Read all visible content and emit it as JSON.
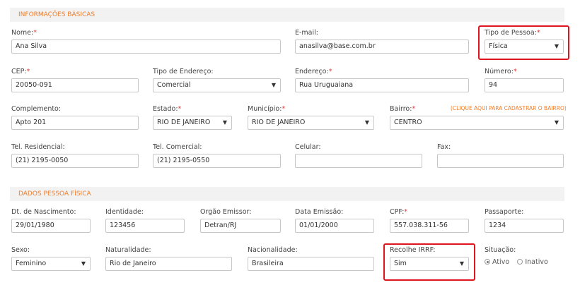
{
  "sections": {
    "basic": "INFORMAÇÕES BÁSICAS",
    "person": "DADOS PESSOA FÍSICA"
  },
  "req": "*",
  "fields": {
    "nome": {
      "label": "Nome:",
      "value": "Ana Silva"
    },
    "email": {
      "label": "E-mail:",
      "value": "anasilva@base.com.br"
    },
    "tipo_pessoa": {
      "label": "Tipo de Pessoa:",
      "value": "Física"
    },
    "cep": {
      "label": "CEP:",
      "value": "20050-091"
    },
    "tipo_endereco": {
      "label": "Tipo de Endereço:",
      "value": "Comercial"
    },
    "endereco": {
      "label": "Endereço:",
      "value": "Rua Uruguaiana"
    },
    "numero": {
      "label": "Número:",
      "value": "94"
    },
    "complemento": {
      "label": "Complemento:",
      "value": "Apto 201"
    },
    "estado": {
      "label": "Estado:",
      "value": "RIO DE JANEIRO"
    },
    "municipio": {
      "label": "Município:",
      "value": "RIO DE JANEIRO"
    },
    "bairro": {
      "label": "Bairro:",
      "value": "CENTRO",
      "link": "(CLIQUE AQUI PARA CADASTRAR O BAIRRO)"
    },
    "tel_res": {
      "label": "Tel. Residencial:",
      "value": "(21) 2195-0050"
    },
    "tel_com": {
      "label": "Tel. Comercial:",
      "value": "(21) 2195-0550"
    },
    "celular": {
      "label": "Celular:",
      "value": ""
    },
    "fax": {
      "label": "Fax:",
      "value": ""
    },
    "nascimento": {
      "label": "Dt. de Nascimento:",
      "value": "29/01/1980"
    },
    "identidade": {
      "label": "Identidade:",
      "value": "123456"
    },
    "orgao": {
      "label": "Orgão Emissor:",
      "value": "Detran/RJ"
    },
    "data_emissao": {
      "label": "Data Emissão:",
      "value": "01/01/2000"
    },
    "cpf": {
      "label": "CPF:",
      "value": "557.038.311-56"
    },
    "passaporte": {
      "label": "Passaporte:",
      "value": "1234"
    },
    "sexo": {
      "label": "Sexo:",
      "value": "Feminino"
    },
    "naturalidade": {
      "label": "Naturalidade:",
      "value": "Rio de Janeiro"
    },
    "nacionalidade": {
      "label": "Nacionalidade:",
      "value": "Brasileira"
    },
    "recolhe_irrf": {
      "label": "Recolhe IRRF:",
      "value": "Sim"
    },
    "situacao": {
      "label": "Situação:",
      "options": [
        "Ativo",
        "Inativo"
      ],
      "selected": "Ativo"
    }
  },
  "caret": "▼",
  "colors": {
    "accent": "#f07d2b",
    "highlight": "#e0141e",
    "required": "#e03a3a"
  }
}
